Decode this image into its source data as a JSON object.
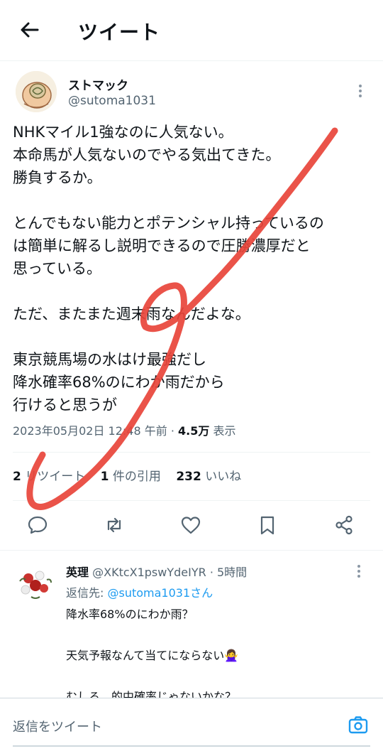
{
  "header": {
    "title": "ツイート"
  },
  "tweet": {
    "author_name": "ストマック",
    "author_handle": "@sutoma1031",
    "text": "NHKマイル1強なのに人気ない。\n本命馬が人気ないのでやる気出てきた。\n勝負するか。\n\nとんでもない能力とポテンシャル持っているの\nは簡単に解るし説明できるので圧勝濃厚だと\n思っている。\n\nただ、またまた週末雨なんだよな。\n\n東京競馬場の水はけ最強だし\n降水確率68%のにわか雨だから\n行けると思うが",
    "timestamp": "2023年05月02日 12:48 午前",
    "separator": " · ",
    "views_count": "4.5万",
    "views_label": " 表示",
    "retweets_count": "2",
    "retweets_label": " リツイート",
    "quotes_count": "1",
    "quotes_label": " 件の引用",
    "likes_count": "232",
    "likes_label": " いいね"
  },
  "reply": {
    "name": "英理",
    "handle": "@XKtcX1pswYdeIYR",
    "time": " · 5時間",
    "reply_to_label": "返信先: ",
    "reply_to_mention": "@sutoma1031さん",
    "text": "降水率68%のにわか雨？\n\n天気予報なんて当てにならない🙅‍♀️\n\nむしろ、的中確率じゃないかな？"
  },
  "compose": {
    "placeholder": "返信をツイート"
  },
  "icons": {
    "back": "arrow-left-icon",
    "more": "more-vertical-icon",
    "reply": "comment-icon",
    "retweet": "retweet-icon",
    "like": "heart-icon",
    "bookmark": "bookmark-icon",
    "share": "share-icon",
    "camera": "camera-icon"
  },
  "colors": {
    "accent": "#1d9bf0",
    "text": "#0f1419",
    "muted": "#536471",
    "scribble": "#e8443a"
  }
}
